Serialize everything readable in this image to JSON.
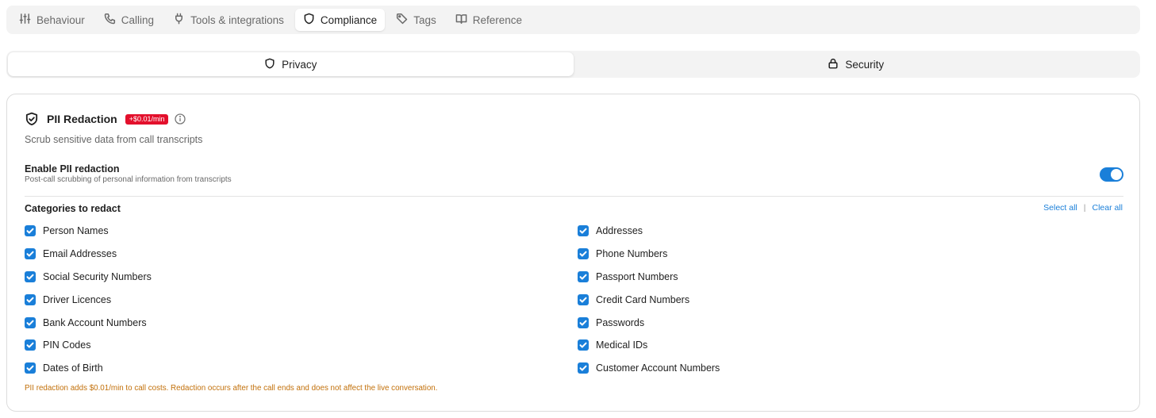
{
  "tabs": [
    {
      "label": "Behaviour",
      "icon": "sliders-icon",
      "active": false
    },
    {
      "label": "Calling",
      "icon": "phone-icon",
      "active": false
    },
    {
      "label": "Tools & integrations",
      "icon": "plug-icon",
      "active": false
    },
    {
      "label": "Compliance",
      "icon": "shield-icon",
      "active": true
    },
    {
      "label": "Tags",
      "icon": "tag-icon",
      "active": false
    },
    {
      "label": "Reference",
      "icon": "book-icon",
      "active": false
    }
  ],
  "segments": {
    "privacy": "Privacy",
    "security": "Security"
  },
  "pii": {
    "title": "PII Redaction",
    "price_badge": "+$0.01/min",
    "description": "Scrub sensitive data from call transcripts",
    "enable_label": "Enable PII redaction",
    "enable_sub": "Post-call scrubbing of personal information from transcripts",
    "enabled": true,
    "categories_label": "Categories to redact",
    "select_all": "Select all",
    "separator": "|",
    "clear_all": "Clear all",
    "left_categories": [
      "Person Names",
      "Email Addresses",
      "Social Security Numbers",
      "Driver Licences",
      "Bank Account Numbers",
      "PIN Codes",
      "Dates of Birth"
    ],
    "right_categories": [
      "Addresses",
      "Phone Numbers",
      "Passport Numbers",
      "Credit Card Numbers",
      "Passwords",
      "Medical IDs",
      "Customer Account Numbers"
    ],
    "note": "PII redaction adds $0.01/min to call costs. Redaction occurs after the call ends and does not affect the live conversation."
  },
  "colors": {
    "accent": "#1a7fd9",
    "badge": "#e3102c",
    "note": "#c2700a"
  }
}
